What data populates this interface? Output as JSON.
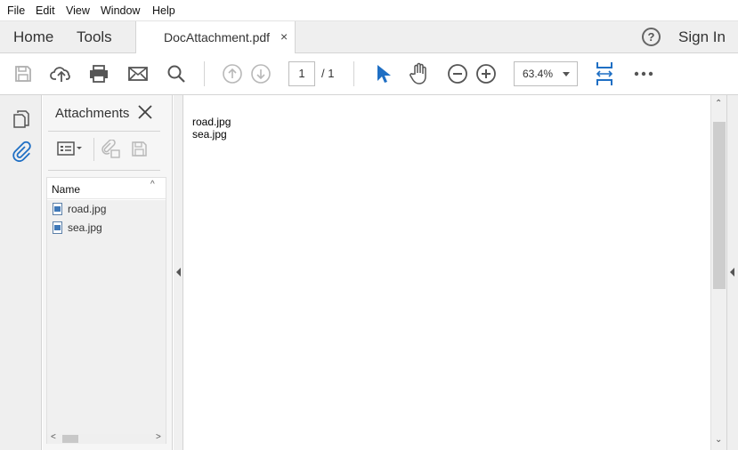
{
  "menu": [
    "File",
    "Edit",
    "View",
    "Window",
    "Help"
  ],
  "tabs": {
    "home": "Home",
    "tools": "Tools",
    "document": "DocAttachment.pdf",
    "close_glyph": "×",
    "help_glyph": "?",
    "sign_in": "Sign In"
  },
  "toolbar": {
    "page_current": "1",
    "page_total": "/ 1",
    "zoom": "63.4%",
    "icons": [
      "save-icon",
      "upload-icon",
      "print-icon",
      "mail-icon",
      "search-icon",
      "page-up-icon",
      "page-down-icon",
      "select-arrow-icon",
      "hand-icon",
      "zoom-out-icon",
      "zoom-in-icon",
      "fit-page-icon",
      "more-icon"
    ]
  },
  "attachments": {
    "title": "Attachments",
    "column": "Name",
    "sort_glyph": "^",
    "files": [
      "road.jpg",
      "sea.jpg"
    ]
  },
  "document": {
    "lines": [
      "road.jpg",
      "sea.jpg"
    ]
  },
  "colors": {
    "accent": "#1f6fc4",
    "panel_bg": "#efefef"
  }
}
